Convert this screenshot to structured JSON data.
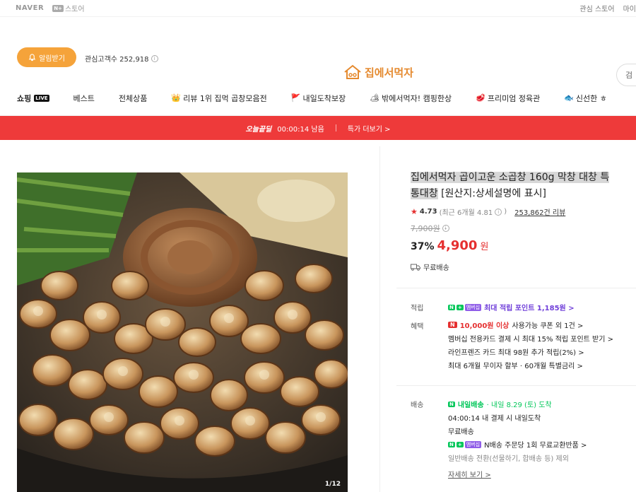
{
  "topbar": {
    "naver": "NAVER",
    "nplus": "N+",
    "store": "스토어",
    "interest_store": "관심 스토어",
    "my": "마이"
  },
  "store": {
    "alarm_button": "알림받기",
    "followers_label": "관심고객수 252,918",
    "logo_text": "집에서먹자",
    "search_placeholder": "검"
  },
  "nav": {
    "items": [
      {
        "label": "쇼핑",
        "badge": "LIVE"
      },
      {
        "label": "베스트"
      },
      {
        "label": "전체상품"
      },
      {
        "label": "리뷰 1위 집먹 곱창모음전",
        "emoji": "👑"
      },
      {
        "label": "내일도착보장",
        "emoji": "🚩"
      },
      {
        "label": "밖에서먹자! 캠핑한상",
        "emoji": "🏕"
      },
      {
        "label": "프리미엄 정육관",
        "emoji": "🥩"
      },
      {
        "label": "신선한 ㅎ",
        "emoji": "🐟"
      }
    ]
  },
  "deal": {
    "title": "오늘끝딜",
    "timer": "00:00:14 남음",
    "more": "특가 더보기 >"
  },
  "product": {
    "title_highlight": "집에서먹자 곱이고운 소곱창 160g 막창 대창 특",
    "title_line2_highlight": "통대창",
    "title_line2_rest": " [원산지:상세설명에 표시]",
    "rating": "4.73",
    "rating_recent": "(최근 6개월 4.81",
    "reviews": "253,862건 리뷰",
    "original_price": "7,900원",
    "discount": "37%",
    "price": "4,900",
    "won": "원",
    "shipping": "무료배송",
    "pager": "1/12"
  },
  "benefits": {
    "points_label": "적립",
    "points_text": "최대 적립 포인트 1,185원 >",
    "benefit_label": "혜택",
    "coupon_amount": "10,000원 이상",
    "coupon_text": "사용가능 쿠폰 외 1건 >",
    "line2": "멤버십 전용카드 결제 시 최대 15% 적립 포인트 받기 >",
    "line3": "라인프렌즈 카드 최대 98원 추가 적립(2%) >",
    "line4": "최대 6개월 무이자 할부 · 60개월 특별금리 >"
  },
  "delivery": {
    "label": "배송",
    "tomorrow": "내일배송",
    "date_text": "· 내일 8.29 (토) 도착",
    "cutoff": "04:00:14  내 결제 시 내일도착",
    "free": "무료배송",
    "return_text": "N배송 주문당 1회 무료교환반품 >",
    "note": "일반배송 전환(선물하기, 합배송 등) 제외",
    "detail": "자세히 보기 >"
  },
  "badges": {
    "n": "N",
    "plus": "+",
    "membership": "멤버십"
  }
}
